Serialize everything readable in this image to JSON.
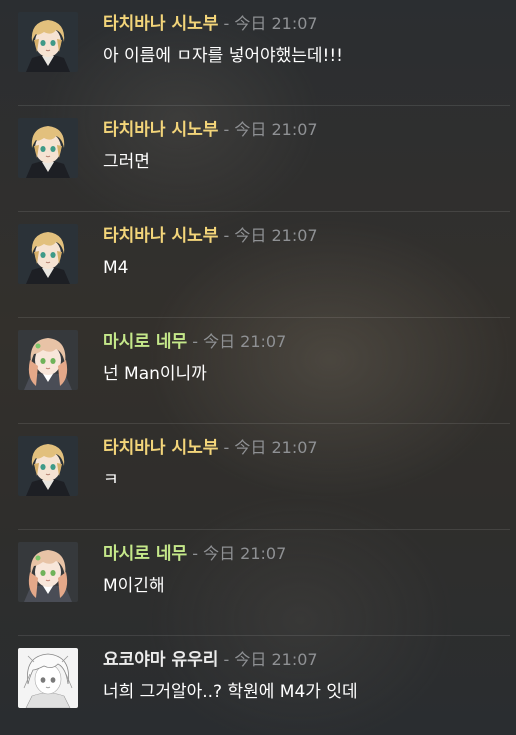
{
  "colors": {
    "tachibana": "#f3d57a",
    "mashiro": "#c5e88a",
    "yokoyama": "#ececec",
    "timestamp": "#8f9194"
  },
  "messages": [
    {
      "author": "타치바나 시노부",
      "separator": "-",
      "timestamp": "今日 21:07",
      "text": "아 이름에 ㅁ자를 넣어야했는데!!!",
      "avatar": "blonde-boy-avatar"
    },
    {
      "author": "타치바나 시노부",
      "separator": "-",
      "timestamp": "今日 21:07",
      "text": "그러면",
      "avatar": "blonde-boy-avatar"
    },
    {
      "author": "타치바나 시노부",
      "separator": "-",
      "timestamp": "今日 21:07",
      "text": "M4",
      "avatar": "blonde-boy-avatar"
    },
    {
      "author": "마시로 네무",
      "separator": "-",
      "timestamp": "今日 21:07",
      "text": "넌 Man이니까",
      "avatar": "pink-hair-girl-avatar"
    },
    {
      "author": "타치바나 시노부",
      "separator": "-",
      "timestamp": "今日 21:07",
      "text": "ㅋ",
      "avatar": "blonde-boy-avatar"
    },
    {
      "author": "마시로 네무",
      "separator": "-",
      "timestamp": "今日 21:07",
      "text": "M이긴해",
      "avatar": "pink-hair-girl-avatar"
    },
    {
      "author": "요코야마 유우리",
      "separator": "-",
      "timestamp": "今日 21:07",
      "text": "너희 그거알아..? 학원에 M4가 잇데",
      "avatar": "white-hair-sketch-avatar"
    }
  ]
}
